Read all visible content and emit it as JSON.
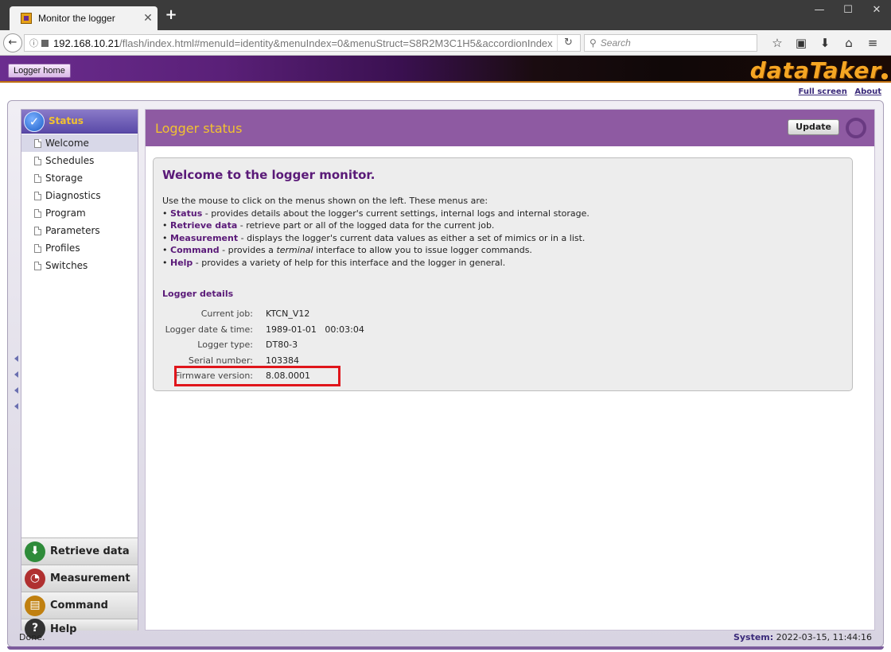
{
  "browser": {
    "tab_title": "Monitor the logger",
    "tab_close": "✕",
    "new_tab": "+",
    "win_min": "—",
    "win_max": "☐",
    "win_close": "✕",
    "back": "←",
    "info": "ⓘ",
    "url_host": "192.168.10.21",
    "url_path": "/flash/index.html#menuId=identity&menuIndex=0&menuStruct=S8R2M3C1H5&accordionIndex",
    "reload": "↻",
    "search_placeholder": "Search",
    "search_icon": "⚲",
    "tools": [
      "☆",
      "▣",
      "⬇",
      "⌂",
      "≡"
    ]
  },
  "header": {
    "logger_home": "Logger home",
    "brand": "dataTaker",
    "full_screen": "Full screen",
    "about": "About"
  },
  "sidebar": {
    "status_label": "Status",
    "status_icon_glyph": "✓",
    "items": [
      {
        "label": "Welcome",
        "selected": true
      },
      {
        "label": "Schedules"
      },
      {
        "label": "Storage"
      },
      {
        "label": "Diagnostics"
      },
      {
        "label": "Program"
      },
      {
        "label": "Parameters"
      },
      {
        "label": "Profiles"
      },
      {
        "label": "Switches"
      }
    ],
    "accordions": [
      {
        "label": "Retrieve data",
        "icon": "download-icon",
        "glyph": "⬇",
        "color": "#2e8b3a"
      },
      {
        "label": "Measurement",
        "icon": "gauge-icon",
        "glyph": "◔",
        "color": "#b03030"
      },
      {
        "label": "Command",
        "icon": "terminal-icon",
        "glyph": "▤",
        "color": "#c08010"
      },
      {
        "label": "Help",
        "icon": "help-icon",
        "glyph": "?",
        "color": "#333333"
      }
    ]
  },
  "main": {
    "title": "Logger status",
    "update_label": "Update",
    "welcome_title": "Welcome to the logger monitor.",
    "intro_line": "Use the mouse to click on the menus shown on the left. These menus are:",
    "bullets": [
      {
        "term": "Status",
        "text": " - provides details about the logger's current settings, internal logs and internal storage."
      },
      {
        "term": "Retrieve data",
        "text": " - retrieve part or all of the logged data for the current job."
      },
      {
        "term": "Measurement",
        "text": " - displays the logger's current data values as either a set of mimics or in a list."
      },
      {
        "term": "Command",
        "text_before": " - provides a ",
        "em": "terminal",
        "text_after": " interface to allow you to issue logger commands."
      },
      {
        "term": "Help",
        "text": " - provides a variety of help for this interface and the logger in general."
      }
    ],
    "details_title": "Logger details",
    "details": [
      {
        "label": "Current job:",
        "value": "KTCN_V12"
      },
      {
        "label": "Logger date & time:",
        "value": "1989-01-01   00:03:04"
      },
      {
        "label": "Logger type:",
        "value": "DT80-3"
      },
      {
        "label": "Serial number:",
        "value": "103384"
      },
      {
        "label": "Firmware version:",
        "value": "8.08.0001"
      }
    ]
  },
  "statusbar": {
    "left": "Done.",
    "system_label": "System:",
    "system_value": "2022-03-15, 11:44:16"
  }
}
